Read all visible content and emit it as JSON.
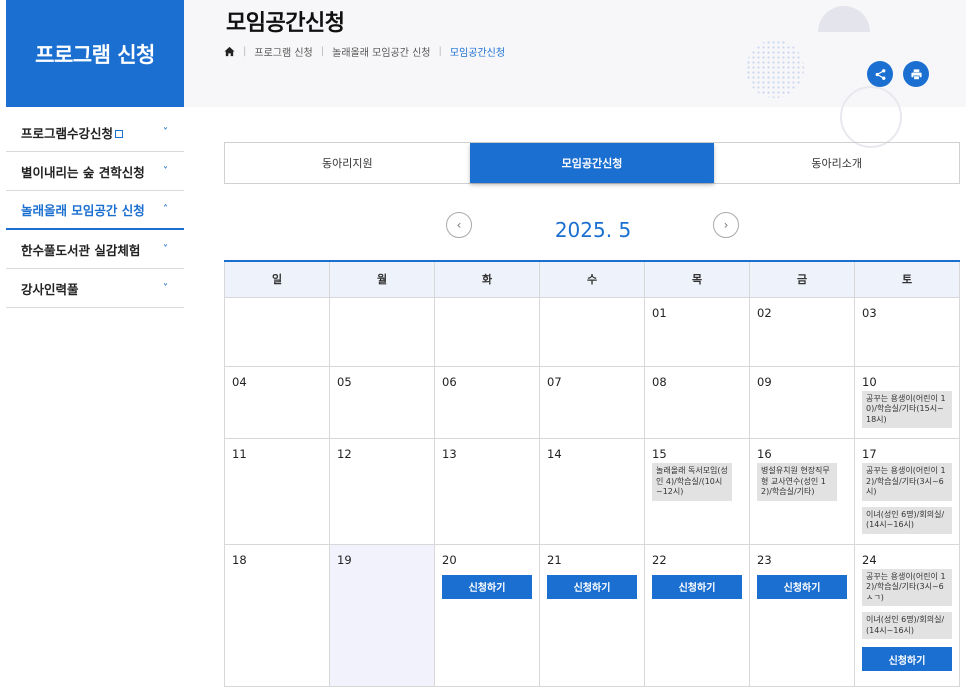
{
  "sidebar": {
    "title": "프로그램 신청",
    "items": [
      {
        "label": "프로그램수강신청",
        "chev": "˅"
      },
      {
        "label": "별이내리는 숲 견학신청",
        "chev": "˅"
      },
      {
        "label": "놀래올래 모임공간 신청",
        "chev": "˄"
      },
      {
        "label": "한수풀도서관 실감체험",
        "chev": "˅"
      },
      {
        "label": "강사인력풀",
        "chev": "˅"
      }
    ]
  },
  "header": {
    "title": "모임공간신청",
    "breadcrumb": [
      "프로그램 신청",
      "놀래올래 모임공간 신청",
      "모임공간신청"
    ]
  },
  "tabs": [
    "동아리지원",
    "모임공간신청",
    "동아리소개"
  ],
  "month": {
    "label": "2025. 5",
    "prev": "‹",
    "next": "›"
  },
  "weekdays": [
    "일",
    "월",
    "화",
    "수",
    "목",
    "금",
    "토"
  ],
  "apply_label": "신청하기",
  "days": {
    "r1": [
      "",
      "",
      "",
      "",
      "01",
      "02",
      "03"
    ],
    "r2": [
      "04",
      "05",
      "06",
      "07",
      "08",
      "09",
      "10"
    ],
    "r3": [
      "11",
      "12",
      "13",
      "14",
      "15",
      "16",
      "17"
    ],
    "r4": [
      "18",
      "19",
      "20",
      "21",
      "22",
      "23",
      "24"
    ]
  },
  "events": {
    "d10": [
      "공꾸는 용생이(어린이 10)/학습실/기타(15시~18시)"
    ],
    "d15": [
      "놀래올래 독서모임(성인 4)/학습실/(10시~12시)"
    ],
    "d16": [
      "병설유치원 현장직무형 교사연수(성인 12)/학습실/기타)"
    ],
    "d17": [
      "공꾸는 용생이(어린이 12)/학습실/기타(3시~6시)",
      "이녀(성인 6명)/회의실/(14시~16시)"
    ],
    "d24": [
      "공꾸는 용생이(어린이 12)/학습실/기타(3시~6ㅅㄱ)",
      "이녀(성인 6명)/회의실/(14시~16시)"
    ]
  },
  "colors": {
    "accent": "#1b6fd1",
    "today_bg": "#f2f2fc",
    "event_bg": "#e2e2e2"
  }
}
